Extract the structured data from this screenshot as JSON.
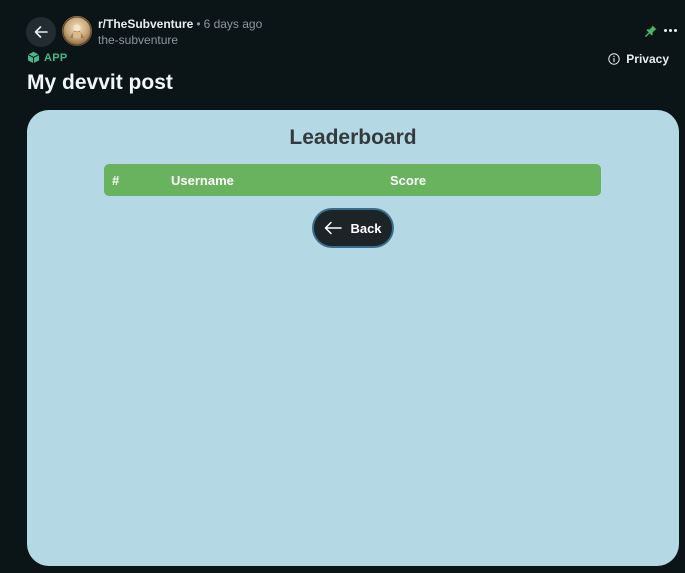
{
  "header": {
    "subreddit": "r/TheSubventure",
    "separator": "•",
    "age": "6 days ago",
    "author": "the-subventure",
    "app_badge": "APP",
    "privacy_label": "Privacy"
  },
  "post": {
    "title": "My devvit post"
  },
  "app": {
    "leaderboard_title": "Leaderboard",
    "columns": {
      "rank": "#",
      "username": "Username",
      "score": "Score"
    },
    "back_label": "Back"
  },
  "colors": {
    "page_bg": "#0b1416",
    "app_bg": "#b5d8e5",
    "header_row": "#6ab35e",
    "app_badge": "#48b888",
    "button_bg": "#1c2428"
  },
  "icons": {
    "nav_back": "arrow-left-icon",
    "pin": "pin-icon",
    "more": "more-horizontal-icon",
    "app": "cube-icon",
    "privacy": "info-icon",
    "button_back": "arrow-left-icon"
  }
}
